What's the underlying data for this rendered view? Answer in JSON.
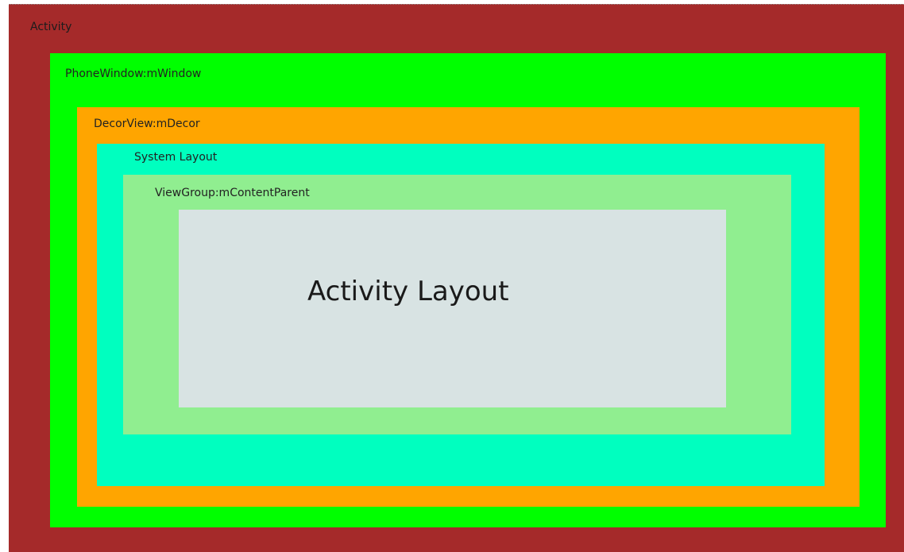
{
  "diagram": {
    "layers": [
      {
        "id": "activity",
        "label": "Activity",
        "color": "#a52a2a"
      },
      {
        "id": "phonewindow",
        "label": "PhoneWindow:mWindow",
        "color": "#00ff00"
      },
      {
        "id": "decorview",
        "label": "DecorView:mDecor",
        "color": "#ffa500"
      },
      {
        "id": "systemlayout",
        "label": "System Layout",
        "color": "#00ffbf"
      },
      {
        "id": "viewgroup",
        "label": "ViewGroup:mContentParent",
        "color": "#90ee90"
      },
      {
        "id": "activitylayout",
        "label": "Activity Layout",
        "color": "#d8e3e3"
      }
    ]
  }
}
